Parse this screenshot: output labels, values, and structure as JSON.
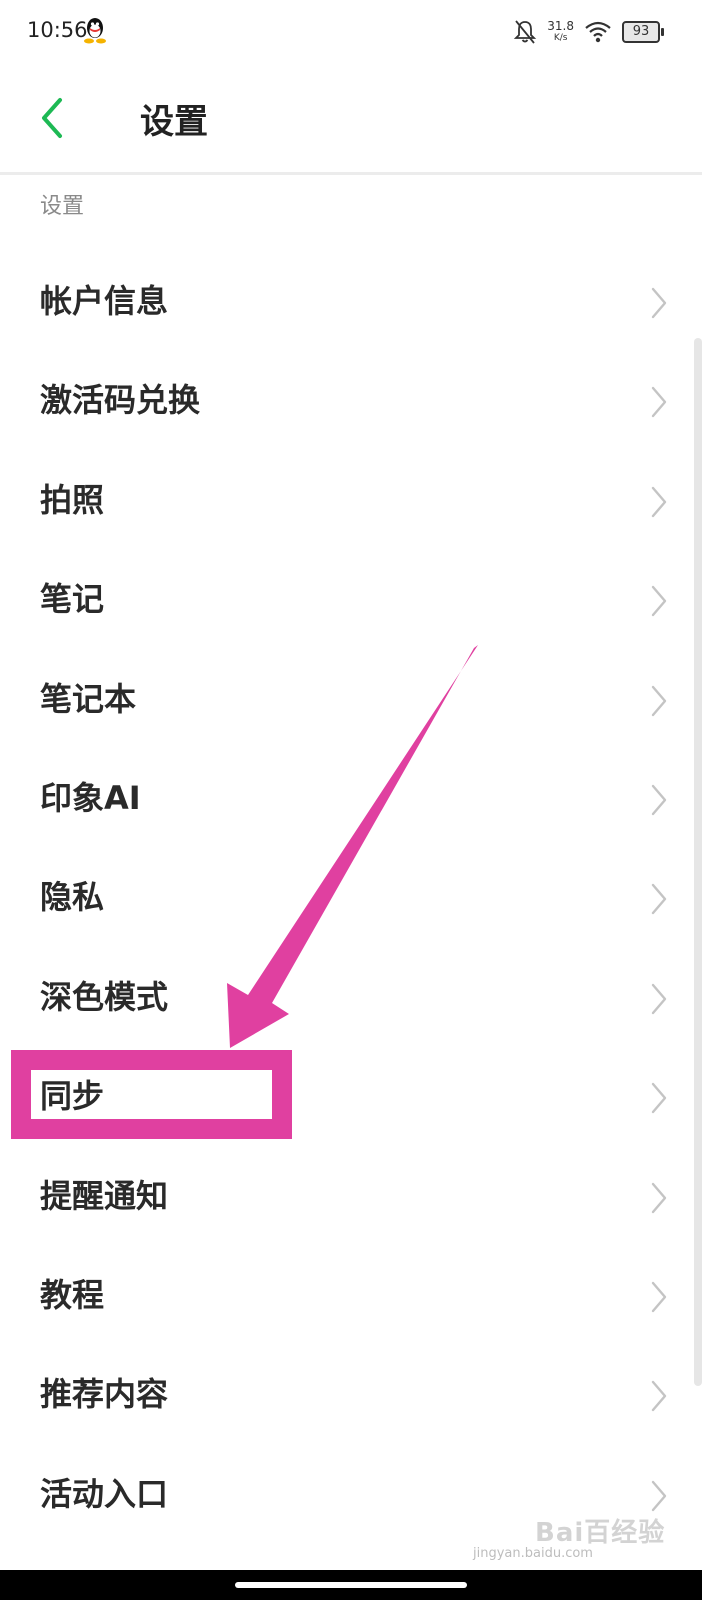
{
  "status_bar": {
    "time": "10:56",
    "speed_value": "31.8",
    "speed_unit": "K/s",
    "battery": "93",
    "icons": [
      "qq-icon",
      "bell-off-icon",
      "wifi-icon",
      "battery-icon"
    ]
  },
  "header": {
    "title": "设置",
    "back_icon": "chevron-left-icon",
    "accent_color": "#1db954"
  },
  "section": {
    "label": "设置"
  },
  "items": [
    {
      "label": "帐户信息"
    },
    {
      "label": "激活码兑换"
    },
    {
      "label": "拍照"
    },
    {
      "label": "笔记"
    },
    {
      "label": "笔记本"
    },
    {
      "label": "印象AI"
    },
    {
      "label": "隐私"
    },
    {
      "label": "深色模式"
    },
    {
      "label": "同步"
    },
    {
      "label": "提醒通知"
    },
    {
      "label": "教程"
    },
    {
      "label": "推荐内容"
    },
    {
      "label": "活动入口"
    }
  ],
  "annotation": {
    "highlight_color": "#e040a0",
    "highlighted_item": "同步"
  },
  "watermark": {
    "logo": "Bai百经验",
    "url": "jingyan.baidu.com"
  }
}
